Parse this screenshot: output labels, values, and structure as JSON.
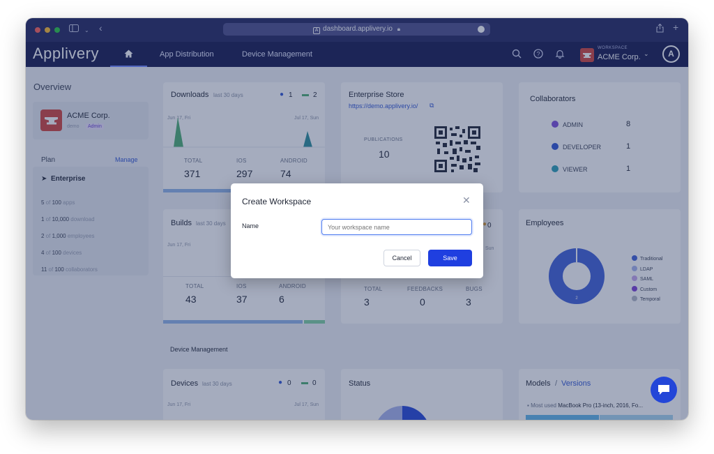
{
  "browser": {
    "url": "dashboard.applivery.io",
    "traffic_colors": [
      "#ff5f57",
      "#febc2e",
      "#28c840"
    ]
  },
  "nav": {
    "logo": "Applivery",
    "links": [
      "App Distribution",
      "Device Management"
    ],
    "workspace_label": "WORKSPACE",
    "workspace_name": "ACME Corp.",
    "avatar_letter": "A"
  },
  "overview": {
    "title": "Overview",
    "org_name": "ACME Corp.",
    "org_slug": "demo",
    "role": "Admin",
    "plan_label": "Plan",
    "manage_label": "Manage",
    "plan_name": "Enterprise",
    "limits": [
      {
        "used": "5",
        "total": "100",
        "unit": "apps"
      },
      {
        "used": "1",
        "total": "10,000",
        "unit": "download"
      },
      {
        "used": "2",
        "total": "1,000",
        "unit": "employees"
      },
      {
        "used": "4",
        "total": "100",
        "unit": "devices"
      },
      {
        "used": "11",
        "total": "100",
        "unit": "collaborators"
      }
    ]
  },
  "downloads": {
    "title": "Downloads",
    "subtitle": "last 30 days",
    "ios_count": "1",
    "android_count": "2",
    "date_start": "Jun 17, Fri",
    "date_end": "Jul 17, Sun",
    "stats": [
      {
        "label": "TOTAL",
        "value": "371"
      },
      {
        "label": "IOS",
        "value": "297"
      },
      {
        "label": "ANDROID",
        "value": "74"
      }
    ]
  },
  "enterprise_store": {
    "title": "Enterprise Store",
    "link": "https://demo.applivery.io/",
    "publications_label": "PUBLICATIONS",
    "publications_value": "10"
  },
  "collaborators": {
    "title": "Collaborators",
    "rows": [
      {
        "label": "ADMIN",
        "value": "8",
        "color": "#7c4ddb"
      },
      {
        "label": "DEVELOPER",
        "value": "1",
        "color": "#2f55d4"
      },
      {
        "label": "VIEWER",
        "value": "1",
        "color": "#2a9fb5"
      }
    ]
  },
  "builds": {
    "title": "Builds",
    "subtitle": "last 30 days",
    "date_start": "Jun 17, Fri",
    "stats": [
      {
        "label": "TOTAL",
        "value": "43"
      },
      {
        "label": "IOS",
        "value": "37"
      },
      {
        "label": "ANDROID",
        "value": "6"
      }
    ]
  },
  "feedback": {
    "count_fragment": "0",
    "date_fragment": "Sun",
    "stats": [
      {
        "label": "TOTAL",
        "value": "3"
      },
      {
        "label": "FEEDBACKS",
        "value": "0"
      },
      {
        "label": "BUGS",
        "value": "3"
      }
    ]
  },
  "employees": {
    "title": "Employees",
    "donut_value": "2",
    "legend": [
      {
        "label": "Traditional",
        "color": "#3f5fd8"
      },
      {
        "label": "LDAP",
        "color": "#a8b4ee"
      },
      {
        "label": "SAML",
        "color": "#c7a6ee"
      },
      {
        "label": "Custom",
        "color": "#7c3fd6"
      },
      {
        "label": "Temporal",
        "color": "#b3b8c6"
      }
    ]
  },
  "device_management": {
    "section_title": "Device Management",
    "devices_title": "Devices",
    "devices_subtitle": "last 30 days",
    "ios_count": "0",
    "android_count": "0",
    "date_start": "Jun 17, Fri",
    "date_end": "Jul 17, Sun",
    "status_title": "Status",
    "models_title": "Models",
    "models_sep": "/",
    "versions_title": "Versions",
    "most_used_label": "Most used",
    "most_used_value": "MacBook Pro (13-inch, 2016, Fo..."
  },
  "modal": {
    "title": "Create Workspace",
    "name_label": "Name",
    "name_placeholder": "Your workspace name",
    "cancel_label": "Cancel",
    "save_label": "Save"
  },
  "colors": {
    "nav_bg": "#14184f",
    "accent": "#1f3fe0",
    "ios_green": "#4caf72",
    "android_teal": "#2a8d9a"
  }
}
